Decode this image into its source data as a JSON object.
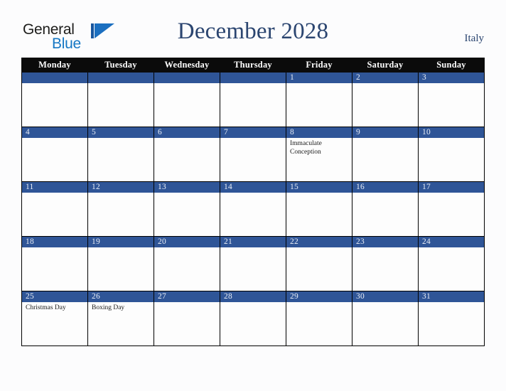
{
  "brand": {
    "name_top": "General",
    "name_bottom": "Blue",
    "mark": "triangle-logo-icon"
  },
  "header": {
    "title": "December 2028",
    "country": "Italy"
  },
  "calendar": {
    "weekday_headers": [
      "Monday",
      "Tuesday",
      "Wednesday",
      "Thursday",
      "Friday",
      "Saturday",
      "Sunday"
    ],
    "colors": {
      "day_header_bg": "#2f5597",
      "weekday_header_bg": "#0b0b0b",
      "weekday_header_text": "#ffffff",
      "day_number_text": "#e9eef7",
      "title_text": "#2b4570",
      "cell_bg": "#fdfdfd",
      "page_bg": "#fcfcfd",
      "brand_blue": "#1577c4"
    },
    "weeks": [
      [
        {
          "day": "",
          "events": []
        },
        {
          "day": "",
          "events": []
        },
        {
          "day": "",
          "events": []
        },
        {
          "day": "",
          "events": []
        },
        {
          "day": "1",
          "events": []
        },
        {
          "day": "2",
          "events": []
        },
        {
          "day": "3",
          "events": []
        }
      ],
      [
        {
          "day": "4",
          "events": []
        },
        {
          "day": "5",
          "events": []
        },
        {
          "day": "6",
          "events": []
        },
        {
          "day": "7",
          "events": []
        },
        {
          "day": "8",
          "events": [
            "Immaculate Conception"
          ]
        },
        {
          "day": "9",
          "events": []
        },
        {
          "day": "10",
          "events": []
        }
      ],
      [
        {
          "day": "11",
          "events": []
        },
        {
          "day": "12",
          "events": []
        },
        {
          "day": "13",
          "events": []
        },
        {
          "day": "14",
          "events": []
        },
        {
          "day": "15",
          "events": []
        },
        {
          "day": "16",
          "events": []
        },
        {
          "day": "17",
          "events": []
        }
      ],
      [
        {
          "day": "18",
          "events": []
        },
        {
          "day": "19",
          "events": []
        },
        {
          "day": "20",
          "events": []
        },
        {
          "day": "21",
          "events": []
        },
        {
          "day": "22",
          "events": []
        },
        {
          "day": "23",
          "events": []
        },
        {
          "day": "24",
          "events": []
        }
      ],
      [
        {
          "day": "25",
          "events": [
            "Christmas Day"
          ]
        },
        {
          "day": "26",
          "events": [
            "Boxing Day"
          ]
        },
        {
          "day": "27",
          "events": []
        },
        {
          "day": "28",
          "events": []
        },
        {
          "day": "29",
          "events": []
        },
        {
          "day": "30",
          "events": []
        },
        {
          "day": "31",
          "events": []
        }
      ]
    ]
  }
}
